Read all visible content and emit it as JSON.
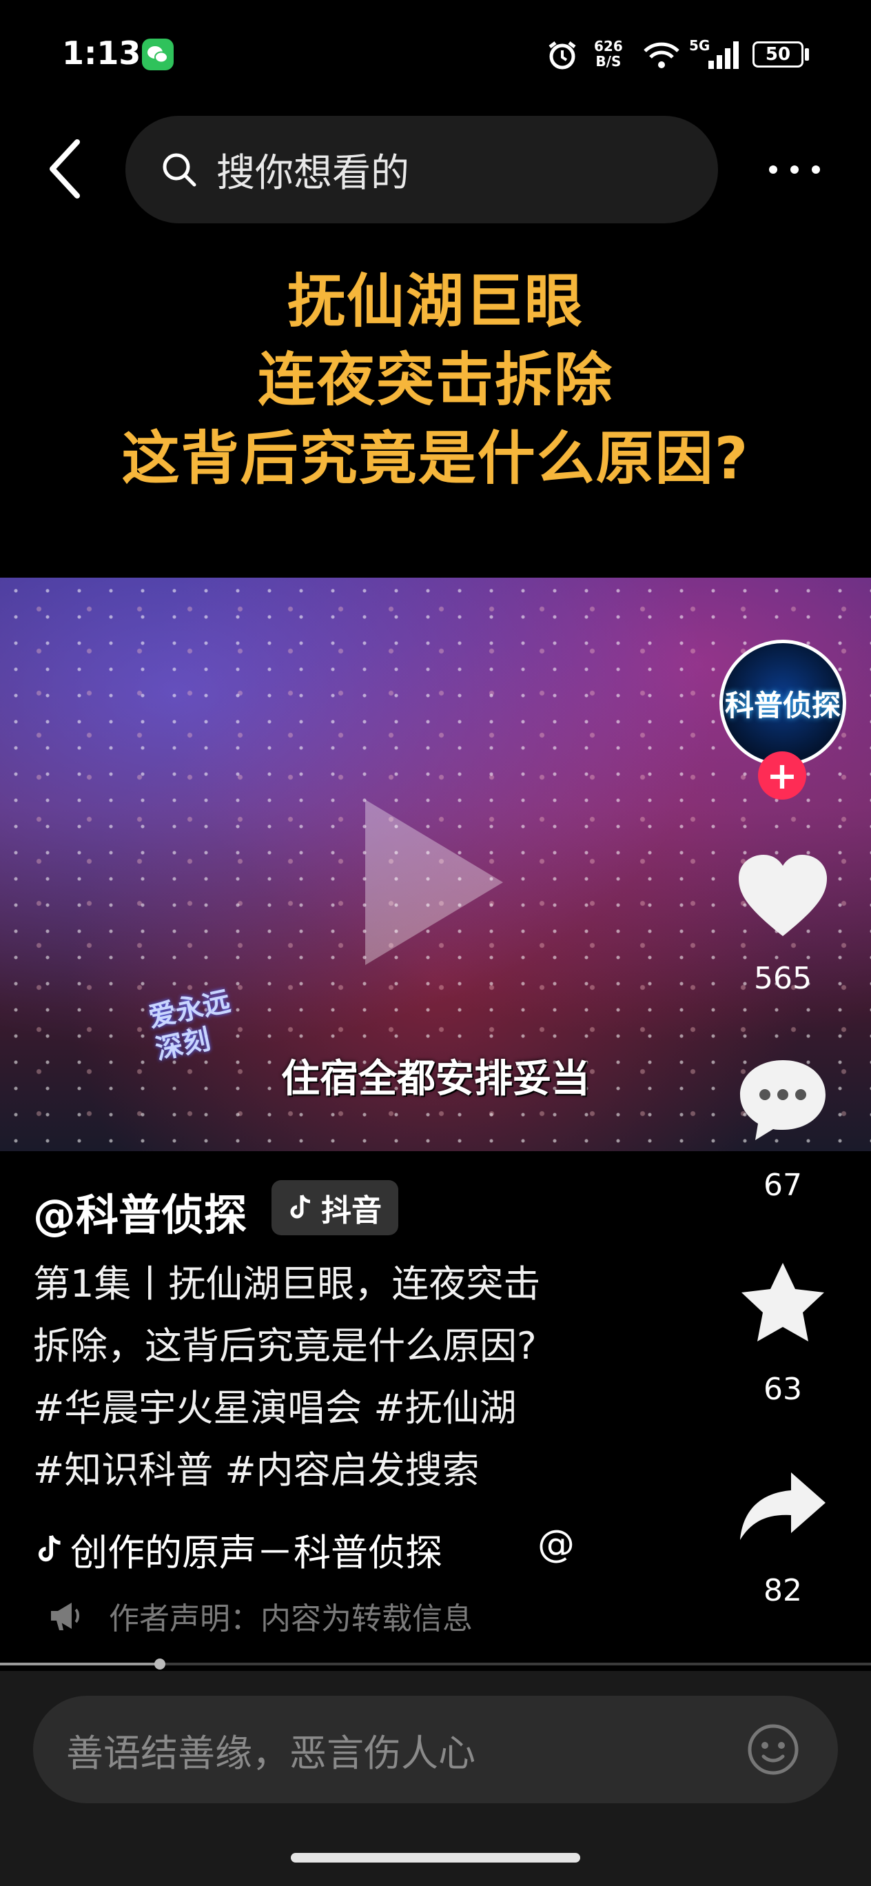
{
  "status_bar": {
    "time": "1:13",
    "net_speed_top": "626",
    "net_speed_bottom": "B/S",
    "network": "5G",
    "battery": "50"
  },
  "top_bar": {
    "search_placeholder": "搜你想看的"
  },
  "video": {
    "title_lines": [
      "抚仙湖巨眼",
      "连夜突击拆除",
      "这背后究竟是什么原因?"
    ],
    "caption": "住宿全都安排妥当",
    "watermark_lines": [
      "爱永远",
      "深刻"
    ]
  },
  "actions": {
    "avatar_text": "科普侦探",
    "like_count": "565",
    "comment_count": "67",
    "favorite_count": "63",
    "share_count": "82"
  },
  "info": {
    "author": "@科普侦探",
    "badge": "抖音",
    "description_lines": [
      "第1集丨抚仙湖巨眼，连夜突击",
      "拆除，这背后究竟是什么原因?",
      "#华晨宇火星演唱会 #抚仙湖",
      "#知识科普 #内容启发搜索"
    ],
    "music": "创作的原声－科普侦探",
    "music_at": "@",
    "notice": "作者声明：内容为转载信息"
  },
  "comment_bar": {
    "placeholder": "善语结善缘，恶言伤人心"
  },
  "colors": {
    "title": "#f6b63b",
    "follow": "#fe2c55",
    "background": "#000000"
  }
}
